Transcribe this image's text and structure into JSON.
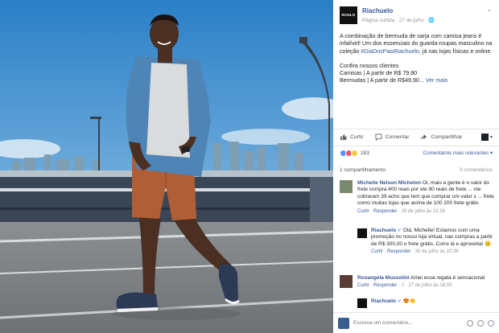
{
  "post": {
    "page_name": "Riachuelo",
    "logo_text": "RCHLO",
    "meta": "Página curtida · 27 de julho · ",
    "paragraph1_a": "A combinação de bermuda de sarja com camisa jeans é infalível! Um dos essenciais do guarda-roupas masculino na coleção ",
    "hashtag": "#DiaDosPaisRiachuelo",
    "paragraph1_b": ", já nas lojas físicas e online.",
    "paragraph2": "Confira nossos clientes",
    "line_camisas": "Camisas | A partir de R$ 79,90",
    "line_bermudas": "Bermudas | A partir de R$49,90...",
    "see_more": "Ver mais"
  },
  "actions": {
    "like": "Curtir",
    "comment": "Comentar",
    "share": "Compartilhar"
  },
  "reactions": {
    "count": "283",
    "sort": "Comentários mais relevantes ▾"
  },
  "shares": {
    "label": "1 compartilhamento",
    "comments_count": "9 comentários"
  },
  "comments": [
    {
      "name": "Michelle Nelson Michelon",
      "text": " Oi, mais a gente é o valor do frete compra 400 reais por ele 90 reais de frete ... me cobraram 39 acho que tem que comprar um valor x ... frete como muitas lojas que acima de 100 200 frete grátis",
      "meta_like": "Curtir",
      "meta_reply": "Responder",
      "meta_time": " · 28 de julho às 13:16"
    },
    {
      "name": "Riachuelo",
      "text": " Olá, Michelle! Estamos com uma promoção no nosso loja virtual, nas compras a partir de R$ 300,00 o frete grátis. Corre lá e aproveita! 😊",
      "meta_like": "Curtir",
      "meta_reply": "Responder",
      "meta_time": " · 30 de julho às 10:38"
    },
    {
      "name": "Rosangela Mussolini",
      "text": " Amei essa regata é sensacional",
      "meta_like": "Curtir",
      "meta_reply": "Responder",
      "meta_time": " · 2 · 27 de julho às 16:05"
    },
    {
      "name": "Riachuelo",
      "text": " 😍👏"
    }
  ],
  "composer": {
    "placeholder": "Escreva um comentário..."
  },
  "colors": {
    "link": "#365899",
    "like_blue": "#5890ff",
    "love_red": "#f25268"
  }
}
